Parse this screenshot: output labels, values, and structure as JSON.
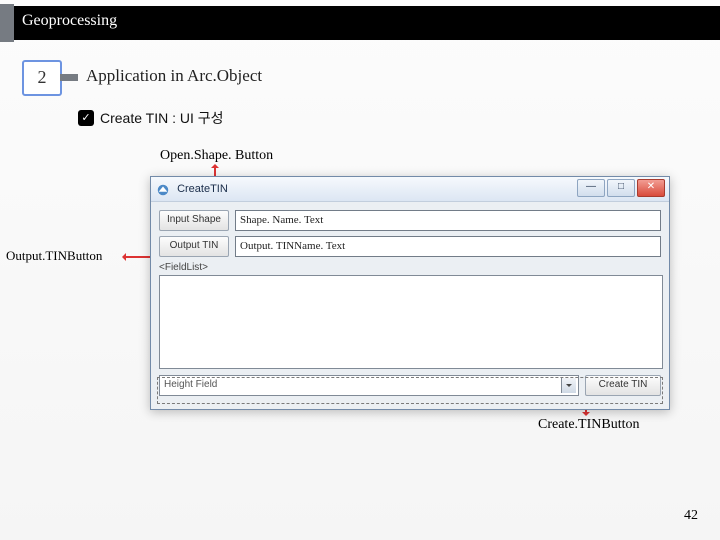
{
  "header": {
    "title": "Geoprocessing"
  },
  "section": {
    "number": "2",
    "title": "Application in Arc.Object"
  },
  "bullet": {
    "label": "Create TIN : UI 구성"
  },
  "annotations": {
    "openShape": "Open.Shape. Button",
    "outputTIN": "Output.TINButton",
    "createTIN": "Create.TINButton"
  },
  "dialog": {
    "title": "CreateTIN",
    "winmin": "—",
    "winmax": "□",
    "winclose": "✕",
    "row1": {
      "button": "Input Shape",
      "field": "Shape. Name. Text"
    },
    "row2": {
      "button": "Output TIN",
      "field": "Output. TINName. Text"
    },
    "listLabel": "<FieldList>",
    "bottom": {
      "combo": "Height Field",
      "create": "Create TIN"
    }
  },
  "page": "42"
}
